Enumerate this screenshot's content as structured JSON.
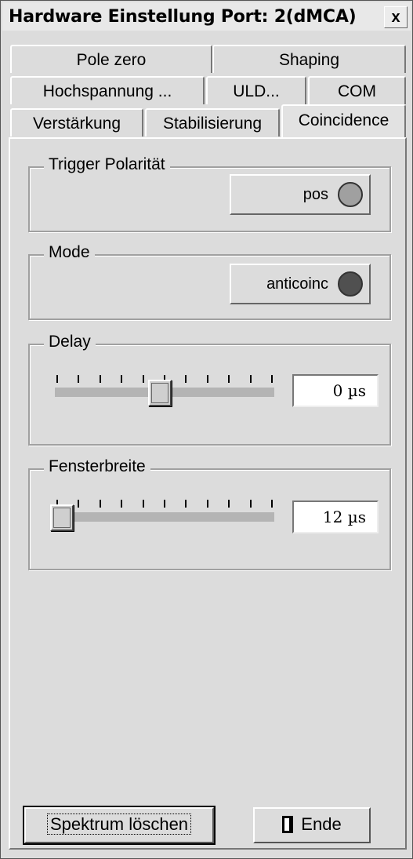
{
  "window": {
    "title": "Hardware Einstellung Port: 2(dMCA)",
    "close_label": "x"
  },
  "tabs_row1": [
    {
      "label": "Pole zero"
    },
    {
      "label": "Shaping"
    }
  ],
  "tabs_row2": [
    {
      "label": "Hochspannung ..."
    },
    {
      "label": "ULD..."
    },
    {
      "label": "COM"
    }
  ],
  "tabs_row3": [
    {
      "label": "Verstärkung"
    },
    {
      "label": "Stabilisierung"
    },
    {
      "label": "Coincidence"
    }
  ],
  "active_tab": "Coincidence",
  "trigger": {
    "group_label": "Trigger Polarität",
    "button_label": "pos",
    "led_color": "#a0a0a0"
  },
  "mode": {
    "group_label": "Mode",
    "button_label": "anticoinc",
    "led_color": "#505050"
  },
  "delay": {
    "group_label": "Delay",
    "value": "0 µs",
    "slider_fraction": 0.5
  },
  "fensterbreite": {
    "group_label": "Fensterbreite",
    "value": "12 µs",
    "slider_fraction": 0.0
  },
  "buttons": {
    "clear_spectrum": "Spektrum löschen",
    "end": "Ende"
  }
}
